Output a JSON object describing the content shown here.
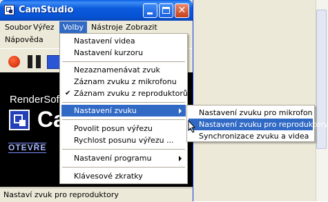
{
  "window": {
    "title": "CamStudio"
  },
  "menubar": {
    "row1": [
      "Soubor",
      "Výřez",
      "Volby",
      "Nástroje",
      "Zobrazit"
    ],
    "row2": [
      "Nápověda"
    ]
  },
  "preview": {
    "line1": "RenderSof",
    "big": "Ca",
    "sub": "OTEVŘE"
  },
  "volby_menu": {
    "items": [
      "Nastavení videa",
      "Nastavení kurzoru",
      "Nezaznamenávat zvuk",
      "Záznam zvuku z mikrofonu",
      "Záznam zvuku z reproduktorů",
      "Nastavení zvuku",
      "Povolit posun výřezu",
      "Rychlost posunu výřezu ...",
      "Nastavení programu",
      "Klávesové zkratky"
    ]
  },
  "submenu": {
    "items": [
      "Nastavení zvuku pro mikrofon",
      "Nastavení zvuku pro reproduktory",
      "Synchronizace zvuku a videa"
    ]
  },
  "status": {
    "text": "Nastaví zvuk pro reproduktory"
  },
  "colors": {
    "highlight": "#316ac5",
    "titlebar": "#0b5bdc"
  }
}
